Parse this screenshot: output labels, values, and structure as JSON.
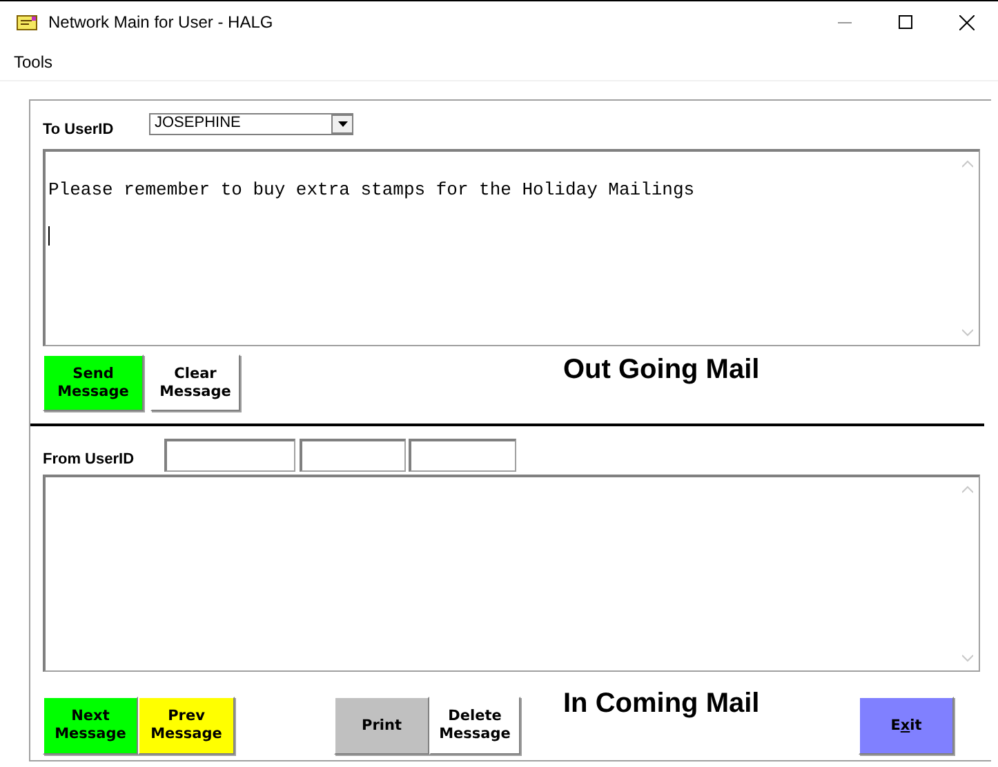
{
  "window": {
    "title": "Network Main for User - HALG"
  },
  "menu": [
    "Tools"
  ],
  "outgoing": {
    "to_label": "To UserID",
    "to_value": "JOSEPHINE",
    "message": "Please remember to buy extra stamps for the Holiday Mailings",
    "caption": "Out Going Mail",
    "buttons": [
      {
        "label": "Send Message",
        "color": "#00ff00"
      },
      {
        "label": "Clear Message",
        "color": "#ffffff"
      }
    ]
  },
  "incoming": {
    "from_label": "From UserID",
    "caption": "In Coming Mail",
    "buttons": [
      {
        "label": "Next Message",
        "color": "#00ff00"
      },
      {
        "label": "Prev Message",
        "color": "#ffff00"
      },
      {
        "label": "Print",
        "color": "#c0c0c0"
      },
      {
        "label": "Delete Message",
        "color": "#ffffff"
      },
      {
        "label_parts": [
          {
            "text": "E",
            "underlined": false
          },
          {
            "text": "x",
            "underlined": true
          },
          {
            "text": "it",
            "underlined": false
          }
        ],
        "color": "#8080ff"
      }
    ]
  }
}
